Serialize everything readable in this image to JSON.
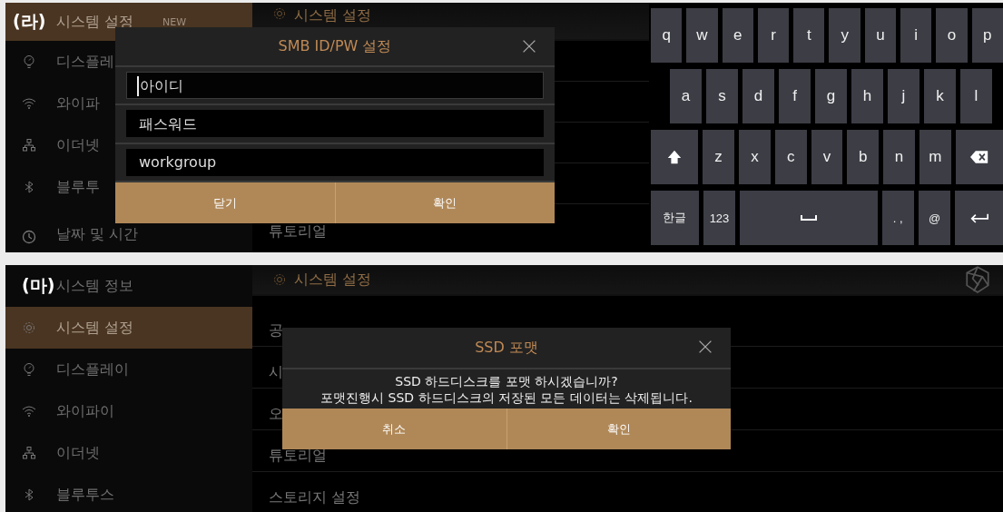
{
  "screens": [
    {
      "kind": "keyboard_dialog",
      "label": "(라)",
      "sidebar": {
        "items": [
          {
            "text": "시스템 설정",
            "selected": true,
            "badge": "NEW"
          },
          {
            "text": "디스플레",
            "selected": false
          },
          {
            "text": "와이파",
            "selected": false
          },
          {
            "text": "이더넷",
            "selected": false
          },
          {
            "text": "블루투",
            "selected": false
          },
          {
            "text": "날짜 및 시간",
            "selected": false
          }
        ]
      },
      "header": {
        "title": "시스템 설정"
      },
      "list": [
        {
          "text": "튜토리얼"
        }
      ],
      "dialog": {
        "kind": "form",
        "title": "SMB ID/PW 설정",
        "fields": [
          {
            "placeholder": "아이디",
            "focused": true
          },
          {
            "placeholder": "패스워드",
            "focused": false
          },
          {
            "value": "workgroup",
            "focused": false
          }
        ],
        "buttons": [
          "닫기",
          "확인"
        ]
      },
      "keyboard": {
        "rows": [
          [
            {
              "kind": "char",
              "label": "q"
            },
            {
              "kind": "char",
              "label": "w"
            },
            {
              "kind": "char",
              "label": "e"
            },
            {
              "kind": "char",
              "label": "r"
            },
            {
              "kind": "char",
              "label": "t"
            },
            {
              "kind": "char",
              "label": "y"
            },
            {
              "kind": "char",
              "label": "u"
            },
            {
              "kind": "char",
              "label": "i"
            },
            {
              "kind": "char",
              "label": "o"
            },
            {
              "kind": "char",
              "label": "p"
            }
          ],
          [
            {
              "kind": "char",
              "label": "a"
            },
            {
              "kind": "char",
              "label": "s"
            },
            {
              "kind": "char",
              "label": "d"
            },
            {
              "kind": "char",
              "label": "f"
            },
            {
              "kind": "char",
              "label": "g"
            },
            {
              "kind": "char",
              "label": "h"
            },
            {
              "kind": "char",
              "label": "j"
            },
            {
              "kind": "char",
              "label": "k"
            },
            {
              "kind": "char",
              "label": "l"
            }
          ],
          [
            {
              "kind": "shift"
            },
            {
              "kind": "char",
              "label": "z"
            },
            {
              "kind": "char",
              "label": "x"
            },
            {
              "kind": "char",
              "label": "c"
            },
            {
              "kind": "char",
              "label": "v"
            },
            {
              "kind": "char",
              "label": "b"
            },
            {
              "kind": "char",
              "label": "n"
            },
            {
              "kind": "char",
              "label": "m"
            },
            {
              "kind": "backspace"
            }
          ],
          [
            {
              "kind": "wide",
              "label": "한글"
            },
            {
              "kind": "char",
              "label": "123"
            },
            {
              "kind": "space"
            },
            {
              "kind": "char",
              "label": ". ,"
            },
            {
              "kind": "char",
              "label": "@"
            },
            {
              "kind": "enter"
            }
          ]
        ]
      }
    },
    {
      "kind": "confirm_dialog",
      "label": "(마)",
      "sidebar": {
        "items": [
          {
            "text": "시스템 정보",
            "selected": false
          },
          {
            "text": "시스템 설정",
            "selected": true
          },
          {
            "text": "디스플레이",
            "selected": false
          },
          {
            "text": "와이파이",
            "selected": false
          },
          {
            "text": "이더넷",
            "selected": false
          },
          {
            "text": "블루투스",
            "selected": false
          }
        ]
      },
      "header": {
        "title": "시스템 설정"
      },
      "list": [
        {
          "text": "공"
        },
        {
          "text": "시"
        },
        {
          "text": "오"
        },
        {
          "text": "튜토리얼"
        },
        {
          "text": "스토리지 설정"
        }
      ],
      "dialog": {
        "kind": "confirm",
        "title": "SSD 포맷",
        "message": [
          "SSD 하드디스크를 포맷 하시겠습니까?",
          "포맷진행시 SSD 하드디스크의 저장된 모든 데이터는 삭제됩니다."
        ],
        "buttons": [
          "취소",
          "확인"
        ]
      }
    }
  ]
}
